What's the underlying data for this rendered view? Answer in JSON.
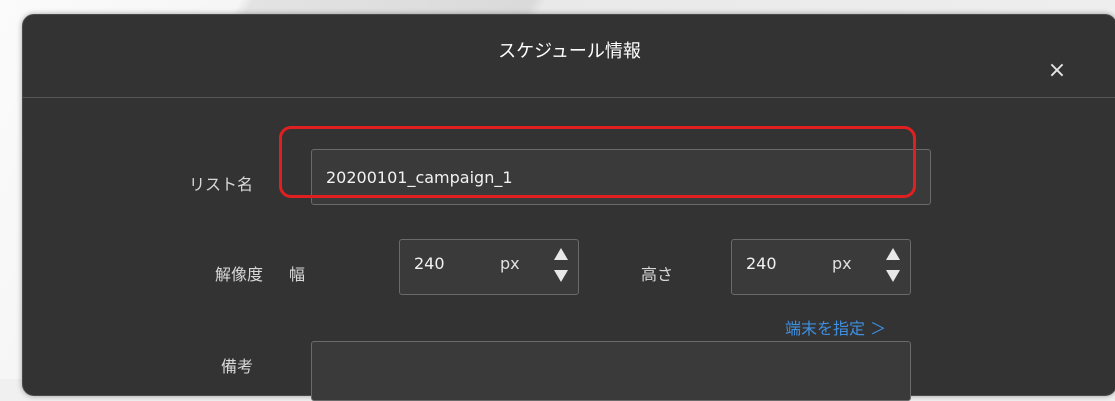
{
  "dialog": {
    "title": "スケジュール情報",
    "close_icon": "×"
  },
  "form": {
    "list_name": {
      "label": "リスト名",
      "value": "20200101_campaign_1"
    },
    "resolution": {
      "label": "解像度",
      "width_label": "幅",
      "width_value": "240",
      "width_unit": "px",
      "height_label": "高さ",
      "height_value": "240",
      "height_unit": "px",
      "device_link": "端末を指定 ＞"
    },
    "notes": {
      "label": "備考",
      "value": ""
    }
  },
  "colors": {
    "dialog_bg": "#333333",
    "highlight": "#e02020",
    "link": "#3f8fe0"
  },
  "icons": [
    "close-icon",
    "spin-up-icon",
    "spin-down-icon",
    "chevron-right-icon"
  ]
}
